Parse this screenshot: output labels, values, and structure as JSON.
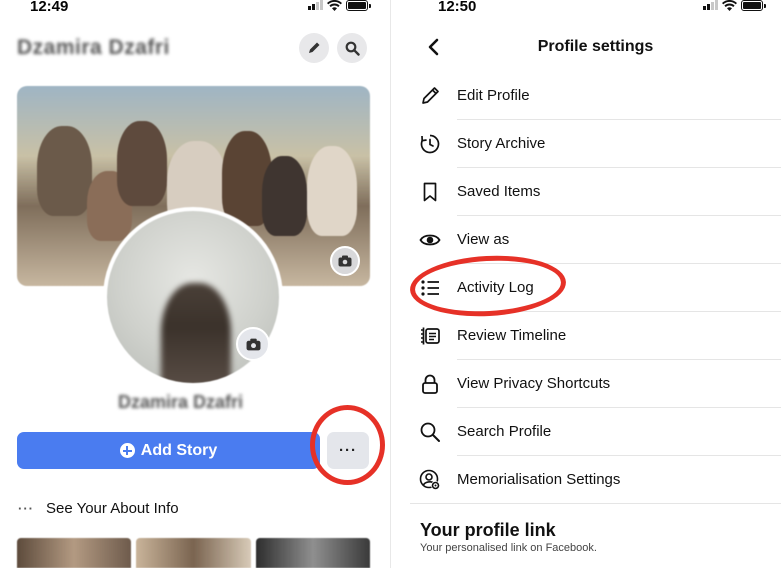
{
  "left_screen": {
    "status_time": "12:49",
    "profile_name": "Dzamira Dzafri",
    "profile_name_below_avatar": "Dzamira Dzafri",
    "add_story_label": "Add Story",
    "more_label": "···",
    "about_label": "See Your About Info",
    "about_dots": "···"
  },
  "right_screen": {
    "status_time": "12:50",
    "title": "Profile settings",
    "menu": [
      {
        "label": "Edit Profile",
        "icon": "pencil-icon"
      },
      {
        "label": "Story Archive",
        "icon": "clock-archive-icon"
      },
      {
        "label": "Saved Items",
        "icon": "bookmark-icon"
      },
      {
        "label": "View as",
        "icon": "eye-icon"
      },
      {
        "label": "Activity Log",
        "icon": "list-icon"
      },
      {
        "label": "Review Timeline",
        "icon": "timeline-icon"
      },
      {
        "label": "View Privacy Shortcuts",
        "icon": "lock-icon"
      },
      {
        "label": "Search Profile",
        "icon": "search-icon"
      },
      {
        "label": "Memorialisation Settings",
        "icon": "person-gear-icon"
      }
    ],
    "profile_link_title": "Your profile link",
    "profile_link_subtitle": "Your personalised link on Facebook."
  },
  "colors": {
    "accent_blue": "#4a7cf0",
    "highlight_red": "#e63127",
    "button_gray": "#e4e6eb"
  }
}
